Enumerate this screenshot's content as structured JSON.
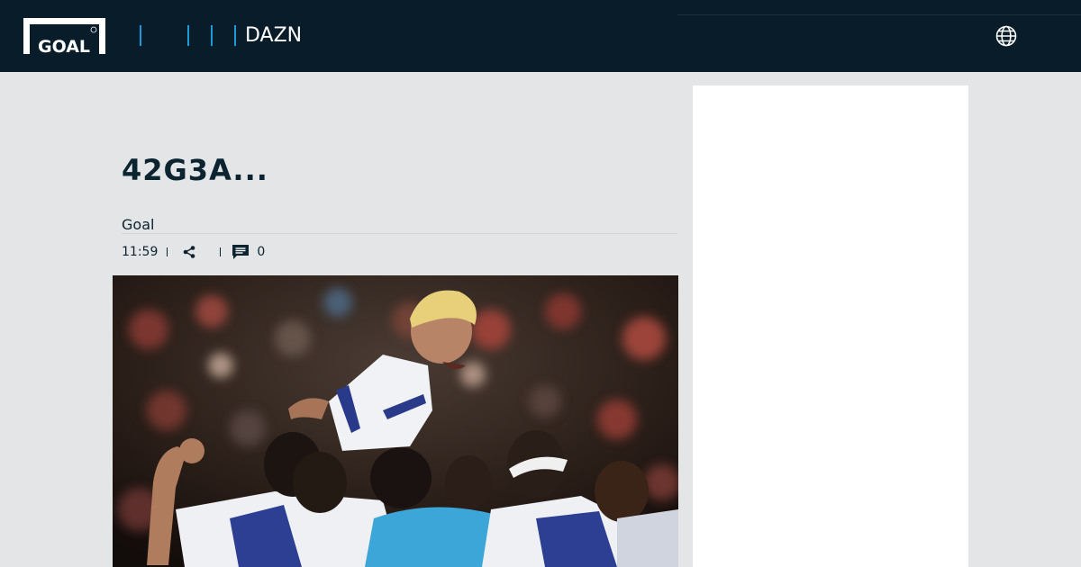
{
  "header": {
    "logo_text": "GOAL",
    "nav_label": "DAZN",
    "globe_icon": "globe-icon"
  },
  "article": {
    "title": "42G3A...",
    "author": "Goal",
    "time": "11:59",
    "comment_count": "0"
  },
  "colors": {
    "header_bg": "#081c29",
    "accent": "#1c9bd8",
    "page_bg": "#e4e5e7",
    "title": "#0c2330"
  }
}
